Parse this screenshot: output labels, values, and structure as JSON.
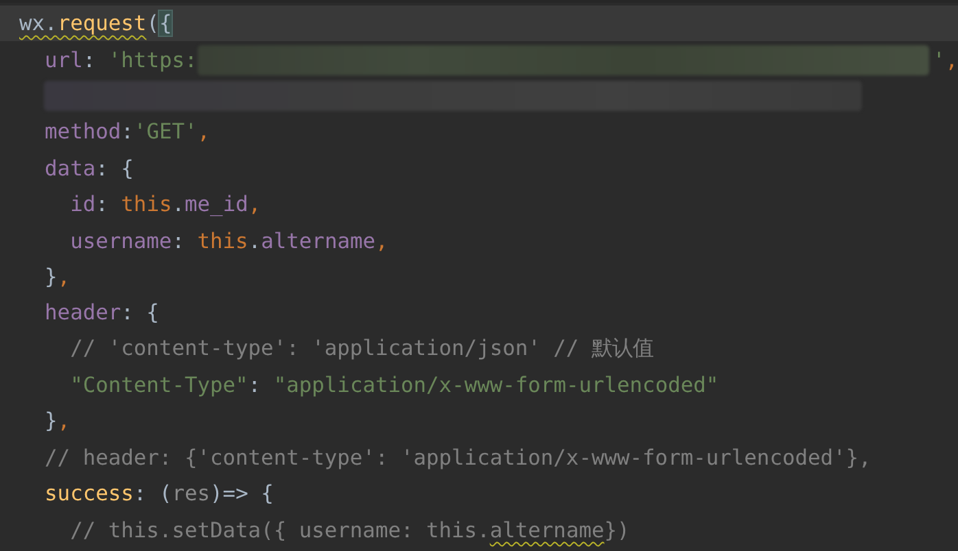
{
  "editor": {
    "lines": [
      {
        "current": true,
        "tokens": [
          {
            "kind": "plain",
            "text": "wx.",
            "warning": true
          },
          {
            "kind": "fn",
            "text": "request",
            "warning": true
          },
          {
            "kind": "plain",
            "text": "("
          },
          {
            "kind": "plain",
            "text": "{",
            "matched": true
          }
        ]
      },
      {
        "current": false,
        "tokens": [
          {
            "kind": "prop",
            "text": "  url"
          },
          {
            "kind": "plain",
            "text": ": "
          },
          {
            "kind": "str",
            "text": "'https:"
          },
          {
            "kind": "redacted"
          },
          {
            "kind": "str",
            "text": "'"
          },
          {
            "kind": "comma",
            "text": ","
          }
        ]
      },
      {
        "current": false,
        "tokens": [
          {
            "kind": "redacted"
          }
        ]
      },
      {
        "current": false,
        "tokens": [
          {
            "kind": "prop",
            "text": "  method"
          },
          {
            "kind": "plain",
            "text": ":"
          },
          {
            "kind": "str",
            "text": "'GET'"
          },
          {
            "kind": "comma",
            "text": ","
          }
        ]
      },
      {
        "current": false,
        "tokens": [
          {
            "kind": "prop",
            "text": "  data"
          },
          {
            "kind": "plain",
            "text": ": {"
          }
        ]
      },
      {
        "current": false,
        "tokens": [
          {
            "kind": "prop",
            "text": "    id"
          },
          {
            "kind": "plain",
            "text": ": "
          },
          {
            "kind": "kw",
            "text": "this"
          },
          {
            "kind": "plain",
            "text": "."
          },
          {
            "kind": "prop",
            "text": "me_id"
          },
          {
            "kind": "comma",
            "text": ","
          }
        ]
      },
      {
        "current": false,
        "tokens": [
          {
            "kind": "prop",
            "text": "    username"
          },
          {
            "kind": "plain",
            "text": ": "
          },
          {
            "kind": "kw",
            "text": "this"
          },
          {
            "kind": "plain",
            "text": "."
          },
          {
            "kind": "prop",
            "text": "altername"
          },
          {
            "kind": "comma",
            "text": ","
          }
        ]
      },
      {
        "current": false,
        "tokens": [
          {
            "kind": "plain",
            "text": "  }"
          },
          {
            "kind": "comma",
            "text": ","
          }
        ]
      },
      {
        "current": false,
        "tokens": [
          {
            "kind": "prop",
            "text": "  header"
          },
          {
            "kind": "plain",
            "text": ": {"
          }
        ]
      },
      {
        "current": false,
        "tokens": [
          {
            "kind": "comment",
            "text": "    // 'content-type': 'application/json' // 默认值"
          }
        ]
      },
      {
        "current": false,
        "tokens": [
          {
            "kind": "str",
            "text": "    \"Content-Type\""
          },
          {
            "kind": "plain",
            "text": ": "
          },
          {
            "kind": "str",
            "text": "\"application/x-www-form-urlencoded\""
          }
        ]
      },
      {
        "current": false,
        "tokens": [
          {
            "kind": "plain",
            "text": "  }"
          },
          {
            "kind": "comma",
            "text": ","
          }
        ]
      },
      {
        "current": false,
        "tokens": [
          {
            "kind": "comment",
            "text": "  // header: {'content-type': 'application/x-www-form-urlencoded'},"
          }
        ]
      },
      {
        "current": false,
        "tokens": [
          {
            "kind": "fn",
            "text": "  success"
          },
          {
            "kind": "plain",
            "text": ": ("
          },
          {
            "kind": "param",
            "text": "res"
          },
          {
            "kind": "plain",
            "text": ")=> {"
          }
        ]
      },
      {
        "current": false,
        "tokens": [
          {
            "kind": "comment",
            "text": "    // this.setData({ username: this."
          },
          {
            "kind": "comment",
            "text": "altername",
            "warning": true
          },
          {
            "kind": "comment",
            "text": "})"
          }
        ]
      }
    ]
  }
}
